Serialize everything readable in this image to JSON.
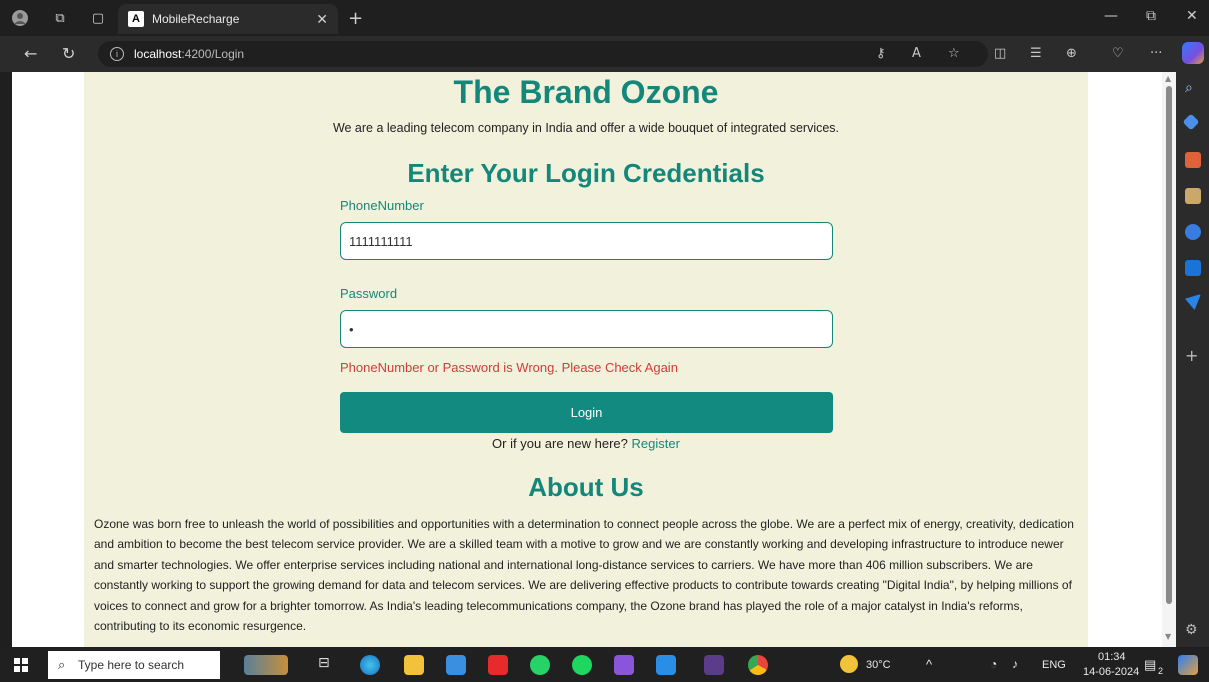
{
  "browser": {
    "tab_title": "MobileRecharge",
    "tab_favicon": "A",
    "url_host": "localhost",
    "url_path": ":4200/Login"
  },
  "page": {
    "brand_title": "The Brand Ozone",
    "tagline": "We are a leading telecom company in India and offer a wide bouquet of integrated services.",
    "login_heading": "Enter Your Login Credentials",
    "phone_label": "PhoneNumber",
    "phone_value": "1111111111",
    "password_label": "Password",
    "password_value": "•",
    "error_message": "PhoneNumber or Password is Wrong. Please Check Again",
    "login_button": "Login",
    "new_here_text": "Or if you are new here?",
    "register_link": "Register",
    "about_heading": "About Us",
    "about_text": "Ozone was born free to unleash the world of possibilities and opportunities with a determination to connect people across the globe. We are a perfect mix of energy, creativity, dedication and ambition to become the best telecom service provider. We are a skilled team with a motive to grow and we are constantly working and developing infrastructure to introduce newer and smarter technologies. We offer enterprise services including national and international long-distance services to carriers. We have more than 406 million subscribers. We are constantly working to support the growing demand for data and telecom services. We are delivering effective products to contribute towards creating \"Digital India\", by helping millions of voices to connect and grow for a brighter tomorrow. As India's leading telecommunications company, the Ozone brand has played the role of a major catalyst in India's reforms, contributing to its economic resurgence."
  },
  "taskbar": {
    "search_placeholder": "Type here to search",
    "weather": "30°C",
    "language": "ENG",
    "time": "01:34",
    "date": "14-06-2024",
    "notification_count": "2"
  },
  "colors": {
    "accent": "#14877a",
    "error": "#d33a3a",
    "page_bg": "#f2f2dc"
  }
}
